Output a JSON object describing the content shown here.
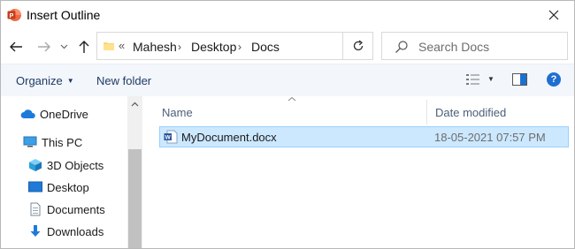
{
  "window": {
    "title": "Insert Outline",
    "close_glyph": "✕"
  },
  "nav": {
    "back_icon": "back-arrow-icon",
    "forward_icon": "forward-arrow-icon",
    "recent_icon": "chevron-down-icon",
    "up_icon": "up-arrow-icon",
    "overflow_glyph": "«",
    "breadcrumbs": [
      "Mahesh",
      "Desktop",
      "Docs"
    ],
    "separator_glyph": "›",
    "refresh_icon": "refresh-icon",
    "search_placeholder": "Search Docs"
  },
  "toolbar": {
    "organize_label": "Organize",
    "organize_caret": "▼",
    "new_folder_label": "New folder",
    "view_caret": "▼",
    "help_glyph": "?"
  },
  "sidebar": {
    "items": [
      {
        "label": "OneDrive",
        "icon": "cloud-icon"
      },
      {
        "label": "This PC",
        "icon": "computer-icon"
      },
      {
        "label": "3D Objects",
        "icon": "cube-icon"
      },
      {
        "label": "Desktop",
        "icon": "desktop-icon"
      },
      {
        "label": "Documents",
        "icon": "documents-icon"
      },
      {
        "label": "Downloads",
        "icon": "download-icon"
      }
    ]
  },
  "filelist": {
    "columns": [
      "Name",
      "Date modified"
    ],
    "files": [
      {
        "name": "MyDocument.docx",
        "date_modified": "18-05-2021 07:57 PM",
        "selected": true,
        "icon": "word-doc-icon"
      }
    ]
  },
  "colors": {
    "selection_bg": "#cce8ff",
    "selection_border": "#99d1ff",
    "toolbar_bg": "#f3f6fb",
    "link_text": "#1e3b66",
    "header_text": "#4c607a",
    "powerpoint_red": "#c43e1c",
    "word_blue": "#2b579a"
  }
}
